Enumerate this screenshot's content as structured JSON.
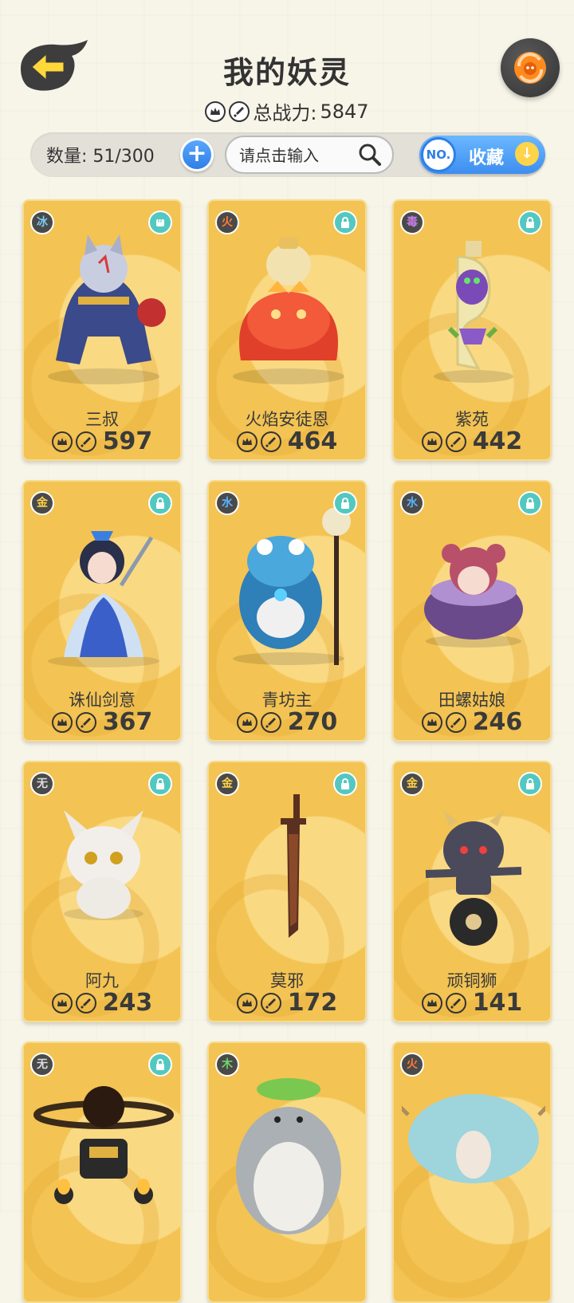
{
  "header": {
    "title": "我的妖灵",
    "total_power_label": "总战力:",
    "total_power": "5847"
  },
  "toolbar": {
    "count_label": "数量: 51/300",
    "add_label": "+",
    "search_placeholder": "请点击输入",
    "sort_badge": "NO.",
    "sort_label": "收藏"
  },
  "colors": {
    "card": "#f3c353",
    "accent_blue": "#3d8ef0",
    "lock": "#53c8c0"
  },
  "cards": [
    {
      "element": "冰",
      "element_color": "#7fc8f0",
      "name": "三叔",
      "power": "597",
      "status_icon": "fist-icon"
    },
    {
      "element": "火",
      "element_color": "#ff7a3a",
      "name": "火焰安徒恩",
      "power": "464",
      "status_icon": "lock-icon"
    },
    {
      "element": "毒",
      "element_color": "#c77de8",
      "name": "紫苑",
      "power": "442",
      "status_icon": "lock-icon"
    },
    {
      "element": "金",
      "element_color": "#ffd34a",
      "name": "诛仙剑意",
      "power": "367",
      "status_icon": "lock-icon"
    },
    {
      "element": "水",
      "element_color": "#5ab4ff",
      "name": "青坊主",
      "power": "270",
      "status_icon": "lock-icon"
    },
    {
      "element": "水",
      "element_color": "#5ab4ff",
      "name": "田螺姑娘",
      "power": "246",
      "status_icon": "lock-icon"
    },
    {
      "element": "无",
      "element_color": "#dddddd",
      "name": "阿九",
      "power": "243",
      "status_icon": "lock-icon"
    },
    {
      "element": "金",
      "element_color": "#ffd34a",
      "name": "莫邪",
      "power": "172",
      "status_icon": "lock-icon"
    },
    {
      "element": "金",
      "element_color": "#ffd34a",
      "name": "顽铜狮",
      "power": "141",
      "status_icon": "lock-icon"
    },
    {
      "element": "无",
      "element_color": "#dddddd",
      "name": "",
      "power": "",
      "status_icon": "lock-icon"
    },
    {
      "element": "木",
      "element_color": "#6fd66a",
      "name": "",
      "power": "",
      "status_icon": ""
    },
    {
      "element": "火",
      "element_color": "#ff7a3a",
      "name": "",
      "power": "",
      "status_icon": ""
    }
  ]
}
